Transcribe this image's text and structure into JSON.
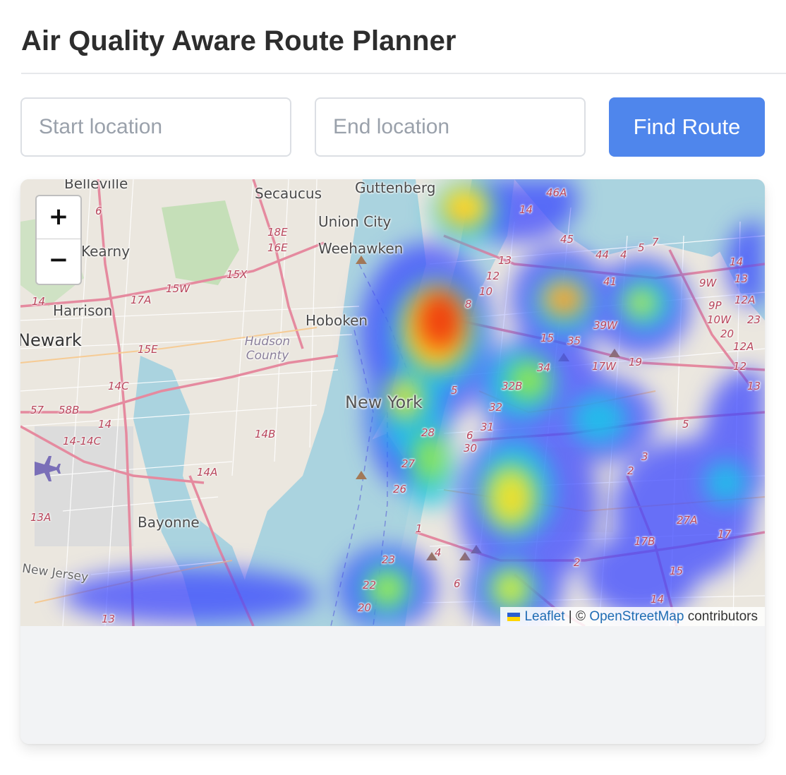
{
  "header": {
    "title": "Air Quality Aware Route Planner"
  },
  "form": {
    "start_placeholder": "Start location",
    "end_placeholder": "End location",
    "start_value": "",
    "end_value": "",
    "submit_label": "Find Route"
  },
  "colors": {
    "accent": "#4f86ec",
    "link": "#1f6cb4"
  },
  "map": {
    "zoom_in_label": "+",
    "zoom_out_label": "−",
    "attribution": {
      "leaflet_label": "Leaflet",
      "separator": " | © ",
      "osm_label": "OpenStreetMap",
      "suffix": " contributors"
    },
    "place_labels": {
      "belleville": "Belleville",
      "secaucus": "Secaucus",
      "guttenberg": "Guttenberg",
      "union_city": "Union City",
      "weehawken": "Weehawken",
      "kearny": "Kearny",
      "harrison": "Harrison",
      "hoboken": "Hoboken",
      "newark": "Newark",
      "hudson_county": "Hudson County",
      "new_york": "New York",
      "bayonne": "Bayonne",
      "new_jersey": "New Jersey"
    },
    "road_labels": [
      "6",
      "46A",
      "14",
      "45",
      "44",
      "4",
      "5",
      "7",
      "18E",
      "16E",
      "15X",
      "15W",
      "17A",
      "14",
      "13",
      "12",
      "10",
      "8",
      "41",
      "9W",
      "14",
      "13",
      "12A",
      "9P",
      "10W",
      "23",
      "20",
      "12A",
      "12",
      "13",
      "15",
      "35",
      "39W",
      "17W",
      "19",
      "15E",
      "14C",
      "34",
      "32B",
      "57",
      "58B",
      "14",
      "14-14C",
      "14B",
      "5",
      "32",
      "31",
      "30",
      "28",
      "27",
      "26",
      "14A",
      "6",
      "5",
      "3",
      "2",
      "13A",
      "27A",
      "17",
      "17B",
      "1",
      "2",
      "4",
      "6",
      "23",
      "22",
      "20",
      "13",
      "15",
      "14"
    ]
  }
}
